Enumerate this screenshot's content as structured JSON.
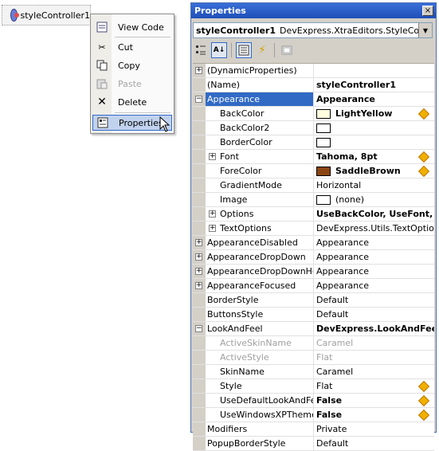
{
  "component": {
    "label": "styleController1",
    "icon": "component-icon"
  },
  "menu": {
    "items": [
      {
        "label": "View Code",
        "icon": "view-code-icon",
        "disabled": false
      },
      {
        "label": "Cut",
        "icon": "cut-icon",
        "disabled": false
      },
      {
        "label": "Copy",
        "icon": "copy-icon",
        "disabled": false
      },
      {
        "label": "Paste",
        "icon": "paste-icon",
        "disabled": true
      },
      {
        "label": "Delete",
        "icon": "delete-icon",
        "disabled": false
      },
      {
        "label": "Properties",
        "icon": "properties-icon",
        "disabled": false,
        "selected": true
      }
    ]
  },
  "properties": {
    "title": "Properties",
    "close": "×",
    "object_name": "styleController1",
    "object_type": "DevExpress.XtraEditors.StyleController",
    "toolbar": [
      "categorized-icon",
      "alphabetical-icon",
      "properties-icon",
      "events-icon",
      "property-pages-icon"
    ],
    "rows": [
      {
        "name": "(DynamicProperties)",
        "value": "",
        "expander": "+"
      },
      {
        "name": "(Name)",
        "value": "styleController1",
        "bold": true
      },
      {
        "name": "Appearance",
        "value": "Appearance",
        "expander": "−",
        "bold": true,
        "selected": true
      },
      {
        "name": "BackColor",
        "value": "LightYellow",
        "indent": true,
        "swatch": "#ffffe0",
        "bold": true,
        "diamond": true
      },
      {
        "name": "BackColor2",
        "value": "",
        "indent": true,
        "swatch": "#ffffff"
      },
      {
        "name": "BorderColor",
        "value": "",
        "indent": true,
        "swatch": "#ffffff"
      },
      {
        "name": "Font",
        "value": "Tahoma, 8pt",
        "indent": true,
        "expander": "+",
        "bold": true,
        "diamond": true
      },
      {
        "name": "ForeColor",
        "value": "SaddleBrown",
        "indent": true,
        "swatch": "#8b4513",
        "bold": true,
        "diamond": true
      },
      {
        "name": "GradientMode",
        "value": "Horizontal",
        "indent": true
      },
      {
        "name": "Image",
        "value": "(none)",
        "indent": true,
        "swatch": "#ffffff"
      },
      {
        "name": "Options",
        "value": "UseBackColor, UseFont, Us",
        "indent": true,
        "expander": "+",
        "bold": true
      },
      {
        "name": "TextOptions",
        "value": "DevExpress.Utils.TextOptions",
        "indent": true,
        "expander": "+"
      },
      {
        "name": "AppearanceDisabled",
        "value": "Appearance",
        "expander": "+"
      },
      {
        "name": "AppearanceDropDown",
        "value": "Appearance",
        "expander": "+"
      },
      {
        "name": "AppearanceDropDownHeac",
        "value": "Appearance",
        "expander": "+"
      },
      {
        "name": "AppearanceFocused",
        "value": "Appearance",
        "expander": "+"
      },
      {
        "name": "BorderStyle",
        "value": "Default"
      },
      {
        "name": "ButtonsStyle",
        "value": "Default"
      },
      {
        "name": "LookAndFeel",
        "value": "DevExpress.LookAndFeel.U",
        "expander": "−",
        "bold": true
      },
      {
        "name": "ActiveSkinName",
        "value": "Caramel",
        "indent": true,
        "disabled": true
      },
      {
        "name": "ActiveStyle",
        "value": "Flat",
        "indent": true,
        "disabled": true
      },
      {
        "name": "SkinName",
        "value": "Caramel",
        "indent": true
      },
      {
        "name": "Style",
        "value": "Flat",
        "indent": true,
        "diamond": true
      },
      {
        "name": "UseDefaultLookAndFeel",
        "value": "False",
        "indent": true,
        "bold": true,
        "diamond": true
      },
      {
        "name": "UseWindowsXPTheme",
        "value": "False",
        "indent": true,
        "bold": true,
        "diamond": true
      },
      {
        "name": "Modifiers",
        "value": "Private"
      },
      {
        "name": "PopupBorderStyle",
        "value": "Default"
      }
    ]
  }
}
